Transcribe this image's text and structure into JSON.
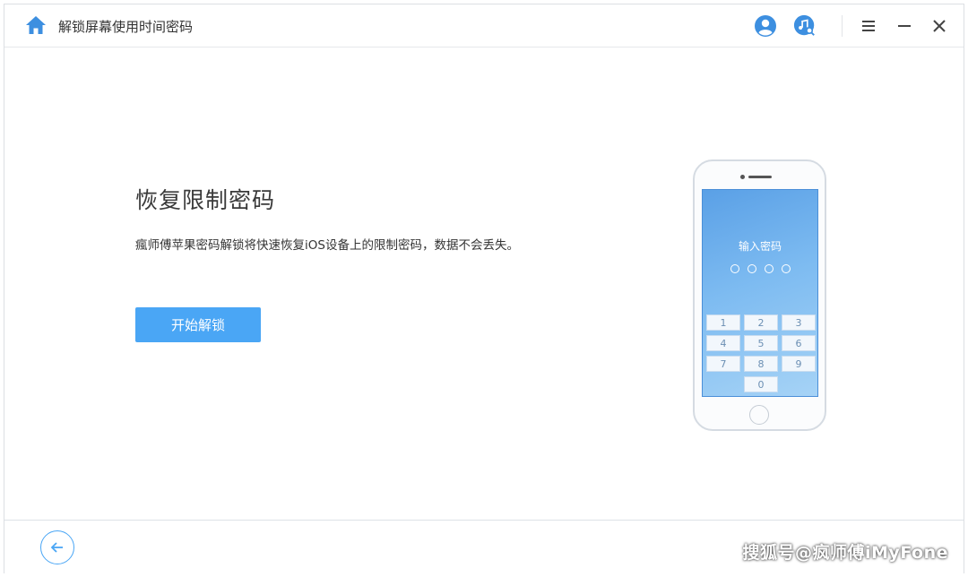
{
  "titlebar": {
    "title": "解锁屏幕使用时间密码",
    "icons": [
      "home-icon",
      "account-icon",
      "music-search-icon",
      "menu-icon",
      "minimize-icon",
      "close-icon"
    ]
  },
  "main": {
    "headline": "恢复限制密码",
    "description": "瘋师傅苹果密码解锁将快速恢复iOS设备上的限制密码，数据不会丢失。",
    "start_button": "开始解锁"
  },
  "phone": {
    "screen_title": "输入密码",
    "keys": [
      "1",
      "2",
      "3",
      "4",
      "5",
      "6",
      "7",
      "8",
      "9",
      "0"
    ]
  },
  "footer": {
    "back_icon": "arrow-left-icon"
  },
  "watermark": "搜狐号@疯师傅iMyFone",
  "colors": {
    "accent": "#4aa6f5",
    "screen_gradient_top": "#5aa0e6",
    "screen_gradient_bottom": "#a6d3f6"
  }
}
